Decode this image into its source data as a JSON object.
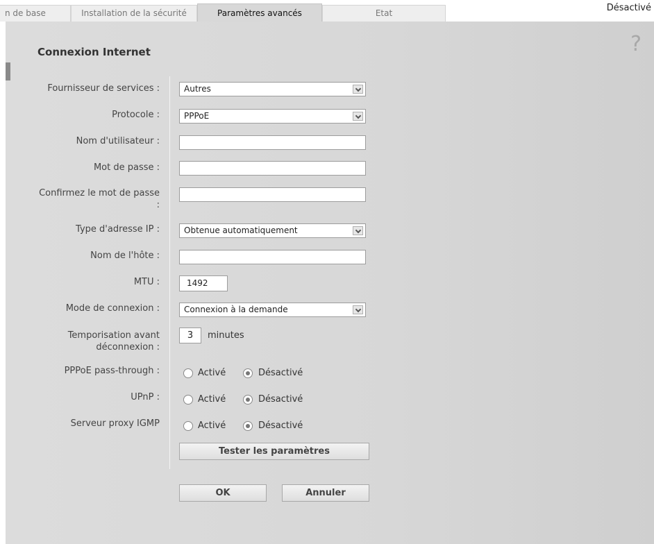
{
  "tabs": [
    {
      "label": "n de base"
    },
    {
      "label": "Installation de la sécurité"
    },
    {
      "label": "Paramètres avancés"
    },
    {
      "label": "Etat"
    }
  ],
  "top_status": "Désactivé",
  "panel": {
    "title": "Connexion Internet",
    "help_glyph": "?"
  },
  "form": {
    "provider": {
      "label": "Fournisseur de services :",
      "value": "Autres"
    },
    "protocol": {
      "label": "Protocole :",
      "value": "PPPoE"
    },
    "username": {
      "label": "Nom d'utilisateur :",
      "value": ""
    },
    "password": {
      "label": "Mot de passe :",
      "value": ""
    },
    "confirm_password": {
      "label_line1": "Confirmez le mot de passe",
      "label_line2": ":",
      "value": ""
    },
    "ip_type": {
      "label": "Type d'adresse IP :",
      "value": "Obtenue automatiquement"
    },
    "hostname": {
      "label": "Nom de l'hôte :",
      "value": ""
    },
    "mtu": {
      "label": "MTU :",
      "value": "1492"
    },
    "connection_mode": {
      "label": "Mode de connexion :",
      "value": "Connexion à la demande"
    },
    "idle_timeout": {
      "label_line1": "Temporisation avant",
      "label_line2": "déconnexion :",
      "value": "3",
      "unit": "minutes"
    },
    "pppoe_passthrough": {
      "label": "PPPoE pass-through :",
      "opt_on": "Activé",
      "opt_off": "Désactivé",
      "selected": "off"
    },
    "upnp": {
      "label": "UPnP :",
      "opt_on": "Activé",
      "opt_off": "Désactivé",
      "selected": "off"
    },
    "igmp_proxy": {
      "label": "Serveur proxy IGMP",
      "opt_on": "Activé",
      "opt_off": "Désactivé",
      "selected": "off"
    }
  },
  "buttons": {
    "test": "Tester les paramètres",
    "ok": "OK",
    "cancel": "Annuler"
  }
}
